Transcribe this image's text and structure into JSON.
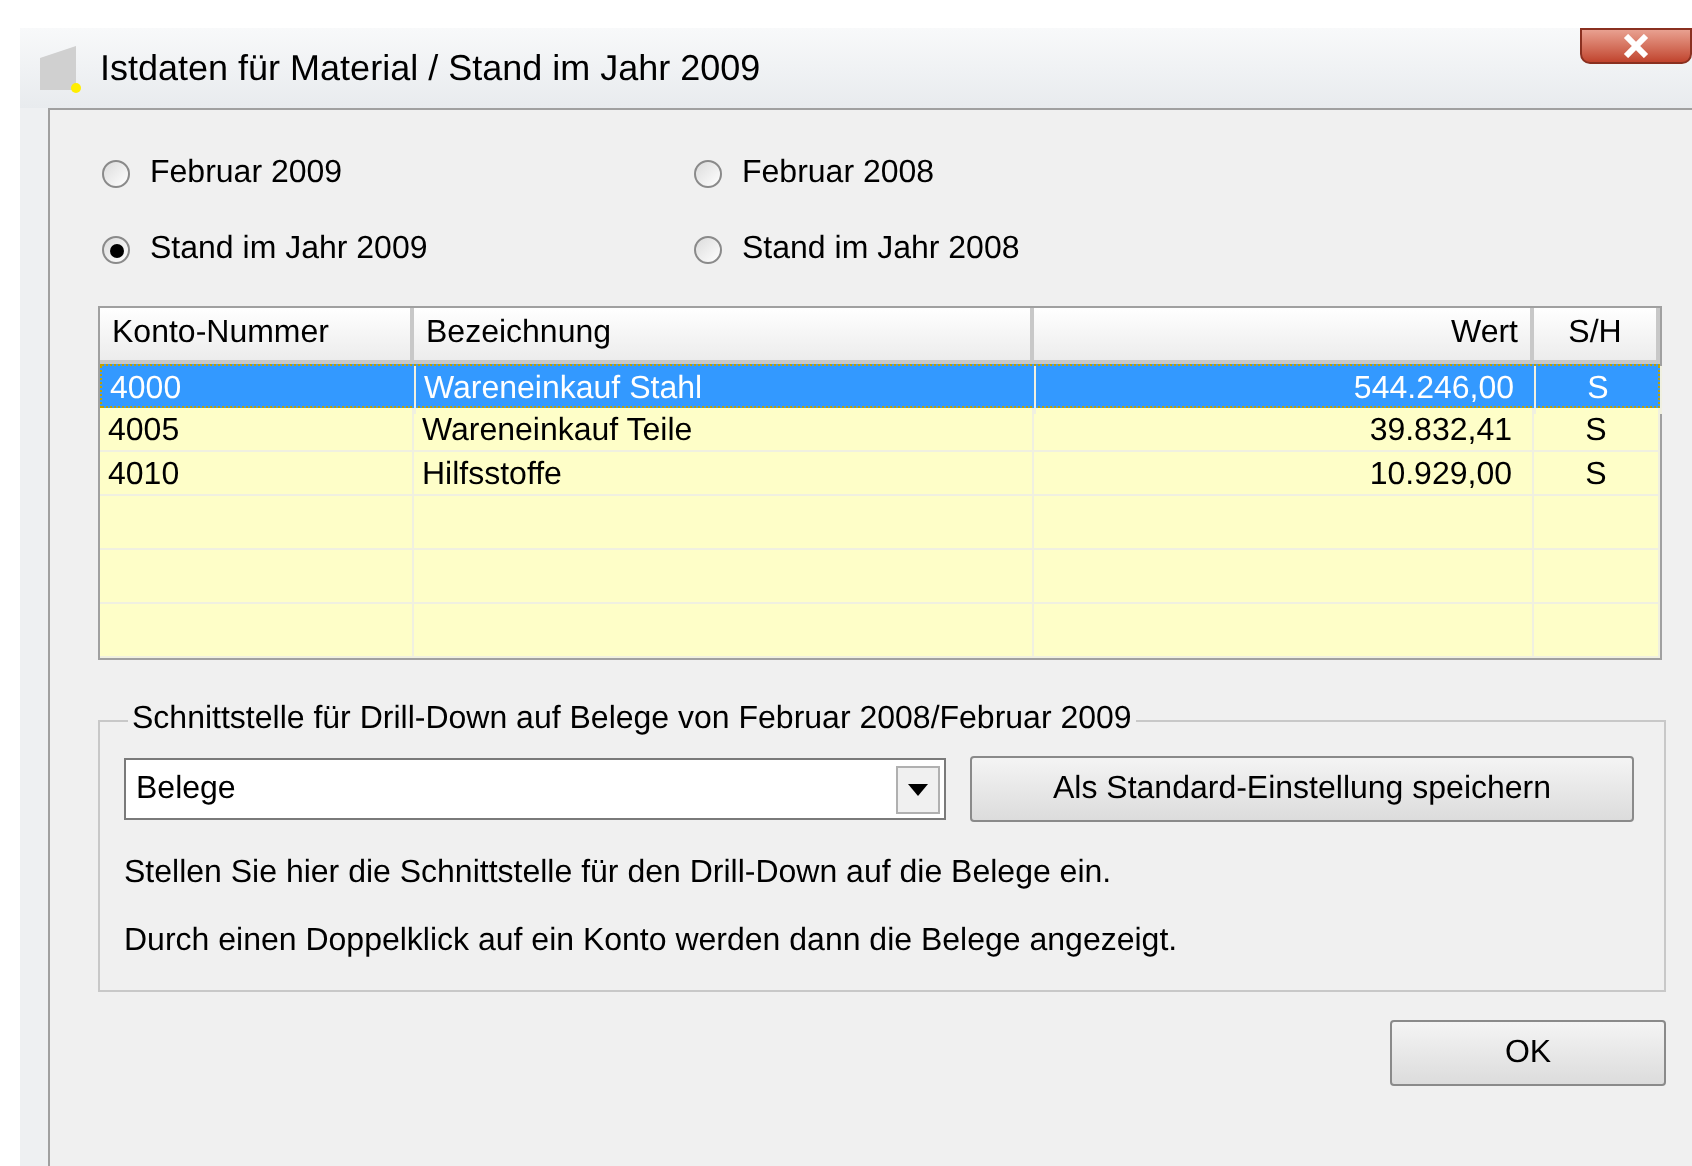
{
  "window": {
    "title": "Istdaten für Material / Stand im Jahr 2009"
  },
  "radios": [
    {
      "label": "Februar 2009",
      "selected": false
    },
    {
      "label": "Februar 2008",
      "selected": false
    },
    {
      "label": "Stand im Jahr 2009",
      "selected": true
    },
    {
      "label": "Stand im Jahr 2008",
      "selected": false
    }
  ],
  "table": {
    "columns": [
      "Konto-Nummer",
      "Bezeichnung",
      "Wert",
      "S/H"
    ],
    "rows": [
      {
        "cells": [
          "4000",
          "Wareneinkauf Stahl",
          "544.246,00",
          "S"
        ],
        "selected": true
      },
      {
        "cells": [
          "4005",
          "Wareneinkauf Teile",
          "39.832,41",
          "S"
        ],
        "selected": false
      },
      {
        "cells": [
          "4010",
          "Hilfsstoffe",
          "10.929,00",
          "S"
        ],
        "selected": false
      }
    ]
  },
  "group": {
    "title": "Schnittstelle für Drill-Down auf Belege von Februar 2008/Februar 2009",
    "dropdown_value": "Belege",
    "save_button": "Als Standard-Einstellung speichern",
    "hints": [
      "Stellen Sie hier die Schnittstelle für den Drill-Down auf die Belege ein.",
      "Durch einen Doppelklick auf ein Konto werden dann die Belege angezeigt."
    ]
  },
  "buttons": [
    "OK"
  ]
}
